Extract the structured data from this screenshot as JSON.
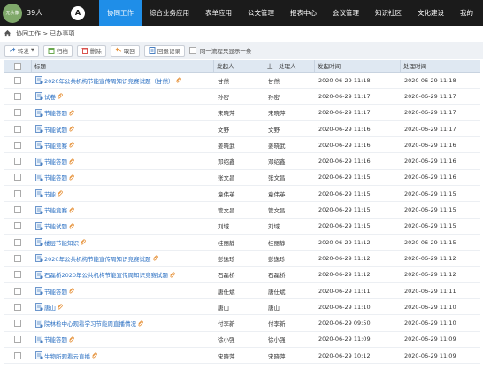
{
  "topbar": {
    "avatar_text": "无头像",
    "online_count": "39人",
    "logo_letter": "A",
    "nav": [
      "协同工作",
      "综合业务应用",
      "表单应用",
      "公文管理",
      "报表中心",
      "会议管理",
      "知识社区",
      "文化建设",
      "我的"
    ]
  },
  "breadcrumb": "协同工作 > 已办事项",
  "toolbar": {
    "forward": "转发",
    "archive": "归档",
    "delete": "删除",
    "revoke": "取回",
    "review": "回退记录",
    "same_flow_label": "同一流程只显示一条"
  },
  "table": {
    "headers": [
      "标题",
      "发起人",
      "上一处理人",
      "发起时间",
      "处理时间"
    ],
    "rows": [
      {
        "title": "2020年公共机构节能宣传周知识竞赛试题（甘然）",
        "clip": true,
        "sender": "甘然",
        "prev": "甘然",
        "start": "2020-06-29 11:18",
        "handled": "2020-06-29 11:18"
      },
      {
        "title": "试卷",
        "clip": true,
        "sender": "孙密",
        "prev": "孙密",
        "start": "2020-06-29 11:17",
        "handled": "2020-06-29 11:17"
      },
      {
        "title": "节能答题",
        "clip": true,
        "sender": "宋晓萍",
        "prev": "宋晓萍",
        "start": "2020-06-29 11:17",
        "handled": "2020-06-29 11:17"
      },
      {
        "title": "节能试题",
        "clip": true,
        "sender": "文野",
        "prev": "文野",
        "start": "2020-06-29 11:16",
        "handled": "2020-06-29 11:17"
      },
      {
        "title": "节能竞赛",
        "clip": true,
        "sender": "姜晓武",
        "prev": "姜晓武",
        "start": "2020-06-29 11:16",
        "handled": "2020-06-29 11:16"
      },
      {
        "title": "节能答题",
        "clip": true,
        "sender": "邓绍鑫",
        "prev": "邓绍鑫",
        "start": "2020-06-29 11:16",
        "handled": "2020-06-29 11:16"
      },
      {
        "title": "节能答题",
        "clip": true,
        "sender": "张文昌",
        "prev": "张文昌",
        "start": "2020-06-29 11:15",
        "handled": "2020-06-29 11:16"
      },
      {
        "title": "节能",
        "clip": true,
        "sender": "章伟英",
        "prev": "章伟英",
        "start": "2020-06-29 11:15",
        "handled": "2020-06-29 11:15"
      },
      {
        "title": "节能竞赛",
        "clip": true,
        "sender": "管文昌",
        "prev": "管文昌",
        "start": "2020-06-29 11:15",
        "handled": "2020-06-29 11:15"
      },
      {
        "title": "节能试题",
        "clip": true,
        "sender": "刘域",
        "prev": "刘域",
        "start": "2020-06-29 11:15",
        "handled": "2020-06-29 11:15"
      },
      {
        "title": "楼层节能知识",
        "clip": true,
        "sender": "桂丽静",
        "prev": "桂丽静",
        "start": "2020-06-29 11:12",
        "handled": "2020-06-29 11:15"
      },
      {
        "title": "2020年公共机构节能宣传周知识竞赛试题",
        "clip": true,
        "sender": "彭逸珍",
        "prev": "彭逸珍",
        "start": "2020-06-29 11:12",
        "handled": "2020-06-29 11:12"
      },
      {
        "title": "石磊桥2020年公共机构节能宣传周知识竞赛试题",
        "clip": true,
        "sender": "石磊桥",
        "prev": "石磊桥",
        "start": "2020-06-29 11:12",
        "handled": "2020-06-29 11:12"
      },
      {
        "title": "节能答题",
        "clip": true,
        "sender": "唐仕斌",
        "prev": "唐仕斌",
        "start": "2020-06-29 11:11",
        "handled": "2020-06-29 11:11"
      },
      {
        "title": "唐山",
        "clip": true,
        "sender": "唐山",
        "prev": "唐山",
        "start": "2020-06-29 11:10",
        "handled": "2020-06-29 11:10"
      },
      {
        "title": "院林检中心观看学习节能周直播情况",
        "clip": true,
        "sender": "付李新",
        "prev": "付李新",
        "start": "2020-06-29 09:50",
        "handled": "2020-06-29 11:10"
      },
      {
        "title": "节能答题",
        "clip": true,
        "sender": "徐小强",
        "prev": "徐小强",
        "start": "2020-06-29 11:09",
        "handled": "2020-06-29 11:09"
      },
      {
        "title": "生物所观看云直播",
        "clip": true,
        "sender": "宋晓萍",
        "prev": "宋晓萍",
        "start": "2020-06-29 10:12",
        "handled": "2020-06-29 11:09"
      }
    ]
  },
  "colors": {
    "nav_active": "#1f8ee8",
    "link": "#2a6fc2",
    "header_bg": "#dfe8f2"
  }
}
